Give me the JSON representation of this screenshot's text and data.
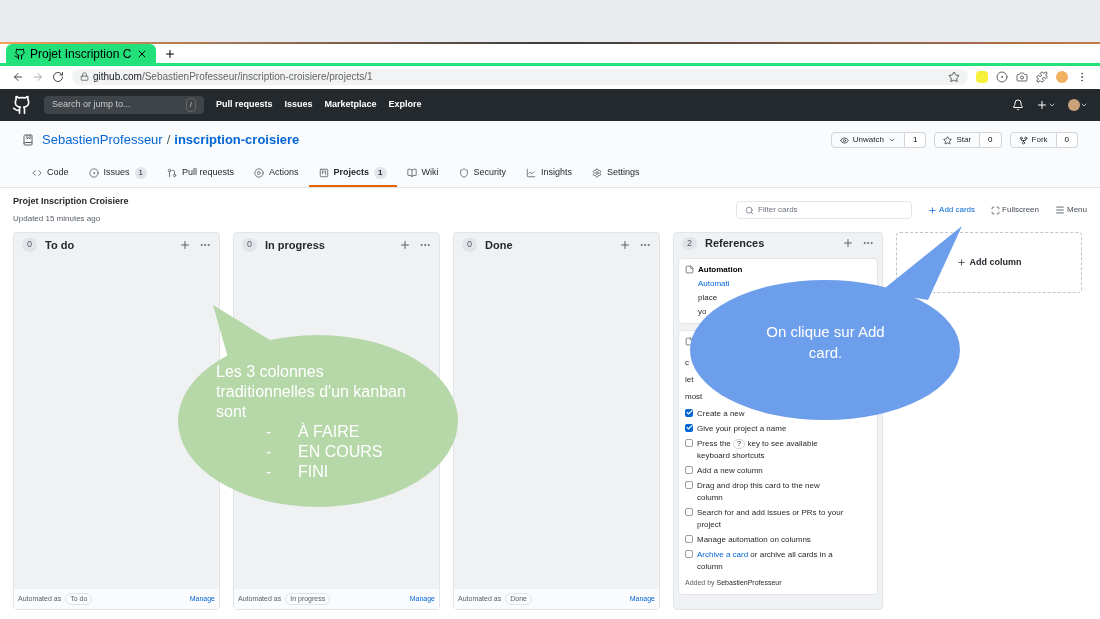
{
  "browser": {
    "tab_title": "Projet Inscription C",
    "url_host": "github.com",
    "url_path": "/SebastienProfesseur/inscription-croisiere/projects/1"
  },
  "github_header": {
    "search_placeholder": "Search or jump to...",
    "search_key": "/",
    "nav": [
      "Pull requests",
      "Issues",
      "Marketplace",
      "Explore"
    ]
  },
  "repo": {
    "owner": "SebastienProfesseur",
    "separator": "/",
    "name": "inscription-croisiere",
    "actions": [
      {
        "label": "Unwatch",
        "count": "1",
        "kind": "watch"
      },
      {
        "label": "Star",
        "count": "0",
        "kind": "star"
      },
      {
        "label": "Fork",
        "count": "0",
        "kind": "fork"
      }
    ],
    "tabs": [
      {
        "label": "Code",
        "kind": "code",
        "selected": false
      },
      {
        "label": "Issues",
        "count": "1",
        "kind": "issues",
        "selected": false
      },
      {
        "label": "Pull requests",
        "kind": "pulls",
        "selected": false
      },
      {
        "label": "Actions",
        "kind": "actions",
        "selected": false
      },
      {
        "label": "Projects",
        "count": "1",
        "kind": "projects",
        "selected": true
      },
      {
        "label": "Wiki",
        "kind": "wiki",
        "selected": false
      },
      {
        "label": "Security",
        "kind": "security",
        "selected": false
      },
      {
        "label": "Insights",
        "kind": "insights",
        "selected": false
      },
      {
        "label": "Settings",
        "kind": "settings",
        "selected": false
      }
    ]
  },
  "project": {
    "title": "Projet Inscription Croisiere",
    "updated": "Updated 15 minutes ago",
    "filter_placeholder": "Filter cards",
    "add_cards": "Add cards",
    "fullscreen": "Fullscreen",
    "menu": "Menu"
  },
  "columns": [
    {
      "name": "To do",
      "count": "0",
      "footer_label": "Automated as",
      "footer_status": "To do",
      "manage": "Manage"
    },
    {
      "name": "In progress",
      "count": "0",
      "footer_label": "Automated as",
      "footer_status": "In progress",
      "manage": "Manage"
    },
    {
      "name": "Done",
      "count": "0",
      "footer_label": "Automated as",
      "footer_status": "Done",
      "manage": "Manage"
    }
  ],
  "references": {
    "name": "References",
    "count": "2",
    "card_1": {
      "title": "Automation",
      "lines": [
        {
          "text": "Automati",
          "link": true
        },
        {
          "text": "place",
          "link": false
        },
        {
          "text": "yo",
          "link": false
        }
      ]
    },
    "card_2": {
      "lines": [
        {
          "text": "c",
          "link": false
        },
        {
          "text": "let",
          "link": false
        },
        {
          "text": "most",
          "link": false
        }
      ],
      "tasks": [
        {
          "checked": true,
          "parts": [
            {
              "kind": "text",
              "text": "Create a new"
            }
          ]
        },
        {
          "checked": true,
          "parts": [
            {
              "kind": "text",
              "text": "Give your project a name"
            }
          ]
        },
        {
          "checked": false,
          "parts": [
            {
              "kind": "text",
              "text": "Press the "
            },
            {
              "kind": "key",
              "text": "?"
            },
            {
              "kind": "text",
              "text": " key to see available keyboard shortcuts"
            }
          ]
        },
        {
          "checked": false,
          "parts": [
            {
              "kind": "text",
              "text": "Add a new column"
            }
          ]
        },
        {
          "checked": false,
          "parts": [
            {
              "kind": "text",
              "text": "Drag and drop this card to the new column"
            }
          ]
        },
        {
          "checked": false,
          "parts": [
            {
              "kind": "text",
              "text": "Search for and add issues or PRs to your project"
            }
          ]
        },
        {
          "checked": false,
          "parts": [
            {
              "kind": "text",
              "text": "Manage automation on columns"
            }
          ]
        },
        {
          "checked": false,
          "parts": [
            {
              "kind": "link",
              "text": "Archive a card"
            },
            {
              "kind": "text",
              "text": " or archive all cards in a column"
            }
          ]
        }
      ],
      "added_by_label": "Added by",
      "added_by": "SebastienProfesseur"
    }
  },
  "add_column": "Add column",
  "callouts": [
    {
      "kind": "green",
      "intro": "Les 3 colonnes traditionnelles d'un kanban sont",
      "items": [
        {
          "marker": "-",
          "text": "À FAIRE"
        },
        {
          "marker": "-",
          "text": "EN COURS"
        },
        {
          "marker": "-",
          "text": "FINI"
        }
      ]
    },
    {
      "kind": "blue",
      "intro": "On clique sur Add card."
    }
  ]
}
